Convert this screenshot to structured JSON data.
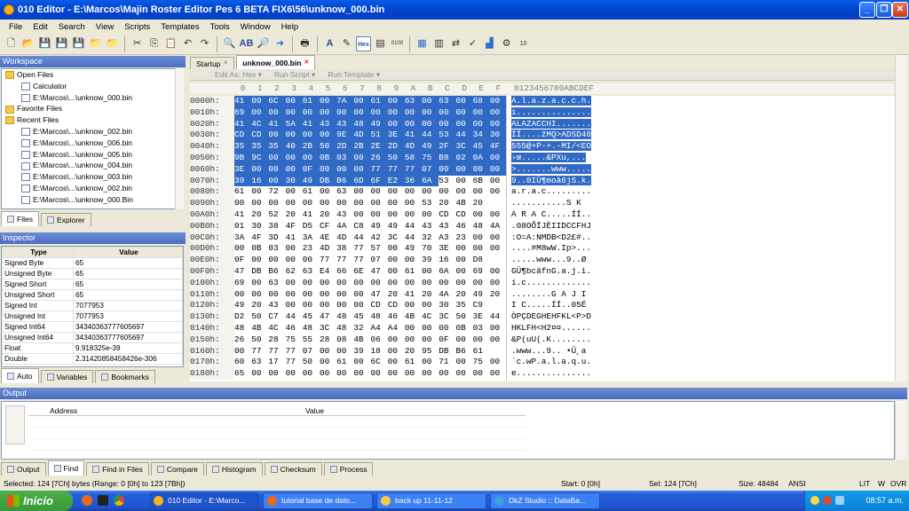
{
  "window": {
    "title": "010 Editor - E:\\Marcos\\Majin Roster Editor Pes 6 BETA FIX6\\56\\unknow_000.bin"
  },
  "menu": [
    "File",
    "Edit",
    "Search",
    "View",
    "Scripts",
    "Templates",
    "Tools",
    "Window",
    "Help"
  ],
  "workspace": {
    "title": "Workspace",
    "items": [
      {
        "label": "Open Files",
        "type": "folder",
        "indent": 0
      },
      {
        "label": "Calculator",
        "type": "doc",
        "indent": 1
      },
      {
        "label": "E:\\Marcos\\...\\unknow_000.bin",
        "type": "doc",
        "indent": 1
      },
      {
        "label": "Favorite Files",
        "type": "folder",
        "indent": 0
      },
      {
        "label": "Recent Files",
        "type": "folder",
        "indent": 0
      },
      {
        "label": "E:\\Marcos\\...\\unknow_002.bin",
        "type": "doc",
        "indent": 1
      },
      {
        "label": "E:\\Marcos\\...\\unknow_006.bin",
        "type": "doc",
        "indent": 1
      },
      {
        "label": "E:\\Marcos\\...\\unknow_005.bin",
        "type": "doc",
        "indent": 1
      },
      {
        "label": "E:\\Marcos\\...\\unknow_004.bin",
        "type": "doc",
        "indent": 1
      },
      {
        "label": "E:\\Marcos\\...\\unknow_003.bin",
        "type": "doc",
        "indent": 1
      },
      {
        "label": "E:\\Marcos\\...\\unknow_002.bin",
        "type": "doc",
        "indent": 1
      },
      {
        "label": "E:\\Marcos\\...\\unknow_000.Bin",
        "type": "doc",
        "indent": 1
      }
    ],
    "tabs": [
      "Files",
      "Explorer"
    ]
  },
  "inspector": {
    "title": "Inspector",
    "col_type": "Type",
    "col_value": "Value",
    "rows": [
      [
        "Signed Byte",
        "65"
      ],
      [
        "Unsigned Byte",
        "65"
      ],
      [
        "Signed Short",
        "65"
      ],
      [
        "Unsigned Short",
        "65"
      ],
      [
        "Signed Int",
        "7077953"
      ],
      [
        "Unsigned Int",
        "7077953"
      ],
      [
        "Signed Int64",
        "34340363777605697"
      ],
      [
        "Unsigned Int64",
        "34340363777605697"
      ],
      [
        "Float",
        "9.918325e-39"
      ],
      [
        "Double",
        "2.31420858458426e-306"
      ]
    ],
    "tabs": [
      "Auto",
      "Variables",
      "Bookmarks"
    ]
  },
  "editor": {
    "tabs": [
      "Startup",
      "unknow_000.bin"
    ],
    "edit_as": "Edit As: Hex ▾",
    "run_script": "Run Script ▾",
    "run_template": "Run Template ▾",
    "col_header": [
      "0",
      "1",
      "2",
      "3",
      "4",
      "5",
      "6",
      "7",
      "8",
      "9",
      "A",
      "B",
      "C",
      "D",
      "E",
      "F"
    ],
    "ascii_header": "0123456789ABCDEF",
    "rows": [
      {
        "addr": "0000h:",
        "bytes": "41 00 6C 00 61 00 7A 00 61 00 63 00 63 00 68 00",
        "ascii": "A.l.a.z.a.c.c.h."
      },
      {
        "addr": "0010h:",
        "bytes": "69 00 00 00 00 00 00 00 00 00 00 00 00 00 00 00",
        "ascii": "i..............."
      },
      {
        "addr": "0020h:",
        "bytes": "41 4C 41 5A 41 43 43 48 49 00 00 00 00 00 00 00",
        "ascii": "ALAZACCHI......."
      },
      {
        "addr": "0030h:",
        "bytes": "CD CD 00 00 00 00 9E 4D 51 3E 41 44 53 44 34 30",
        "ascii": "ÍÍ....žMQ>ADSD40"
      },
      {
        "addr": "0040h:",
        "bytes": "35 35 35 40 2B 50 2D 2B 2E 2D 4D 49 2F 3C 45 4F",
        "ascii": "555@+P-+.-MI/<EO"
      },
      {
        "addr": "0050h:",
        "bytes": "9B 9C 00 00 00 0B 03 00 26 50 58 75 B8 02 0A 00",
        "ascii": "›œ.....&PXu,..."
      },
      {
        "addr": "0060h:",
        "bytes": "3E 00 00 00 0F 00 00 00 77 77 77 07 00 00 00 00",
        "ascii": ">.......www....."
      },
      {
        "addr": "0070h:",
        "bytes": "39 16 00 30 49 DB B6 6D 6F E2 36 6A 53 00 6B 00",
        "ascii": "9..0IÛ¶moâ6jS.k."
      },
      {
        "addr": "0080h:",
        "bytes": "61 00 72 00 61 00 63 00 00 00 00 00 00 00 00 00",
        "ascii": "a.r.a.c........."
      },
      {
        "addr": "0090h:",
        "bytes": "00 00 00 00 00 00 00 00 00 00 00 53 20 4B 20",
        "ascii": "...........S K "
      },
      {
        "addr": "00A0h:",
        "bytes": "41 20 52 20 41 20 43 00 00 00 00 00 CD CD 00 00",
        "ascii": "A R A C.....ÍÍ.."
      },
      {
        "addr": "00B0h:",
        "bytes": "01 30 38 4F D5 CF 4A C8 49 49 44 43 43 46 48 4A",
        "ascii": ".08OÕÏJÈIIDCCFHJ"
      },
      {
        "addr": "00C0h:",
        "bytes": "3A 4F 3D 41 3A 4E 4D 44 42 3C 44 32 A3 23 00 00",
        "ascii": ":O=A:NMDB<D2£#.."
      },
      {
        "addr": "00D0h:",
        "bytes": "00 0B 03 00 23 4D 38 77 57 00 49 70 3E 00 00 00",
        "ascii": "....#M8wW.Ip>..."
      },
      {
        "addr": "00E0h:",
        "bytes": "0F 00 00 00 00 77 77 77 07 00 00 39 16 00 D8",
        "ascii": ".....www...9..Ø"
      },
      {
        "addr": "00F0h:",
        "bytes": "47 DB B6 62 63 E4 66 6E 47 00 61 00 6A 00 69 00",
        "ascii": "GÛ¶bcäfnG.a.j.i."
      },
      {
        "addr": "0100h:",
        "bytes": "69 00 63 00 00 00 00 00 00 00 00 00 00 00 00 00",
        "ascii": "i.c............."
      },
      {
        "addr": "0110h:",
        "bytes": "00 00 00 00 00 00 00 00 47 20 41 20 4A 20 49 20",
        "ascii": "........G A J I "
      },
      {
        "addr": "0120h:",
        "bytes": "49 20 43 00 00 00 00 00 CD CD 00 00 30 35 C9",
        "ascii": "I C.....ÍÍ..05É"
      },
      {
        "addr": "0130h:",
        "bytes": "D2 50 C7 44 45 47 48 45 48 46 4B 4C 3C 50 3E 44",
        "ascii": "ÒPÇDEGHEHFKL<P>D"
      },
      {
        "addr": "0140h:",
        "bytes": "48 4B 4C 46 48 3C 48 32 A4 A4 00 00 00 0B 03 00",
        "ascii": "HKLFH<H2¤¤......"
      },
      {
        "addr": "0150h:",
        "bytes": "26 50 28 75 55 28 08 4B 06 00 00 00 0F 00 00 00",
        "ascii": "&P(uU(.K........"
      },
      {
        "addr": "0160h:",
        "bytes": "00 77 77 77 07 00 00 39 18 00 20 95 DB B6 61",
        "ascii": ".www...9.. •Û¸a"
      },
      {
        "addr": "0170h:",
        "bytes": "60 63 17 77 50 00 61 00 6C 00 61 00 71 00 75 00",
        "ascii": "`c.wP.a.l.a.q.u."
      },
      {
        "addr": "0180h:",
        "bytes": "65 00 00 00 00 00 00 00 00 00 00 00 00 00 00 00",
        "ascii": "e..............."
      }
    ]
  },
  "output": {
    "title": "Output",
    "col_address": "Address",
    "col_value": "Value",
    "tabs": [
      "Output",
      "Find",
      "Find in Files",
      "Compare",
      "Histogram",
      "Checksum",
      "Process"
    ]
  },
  "status": {
    "selected": "Selected: 124 [7Ch] bytes (Range: 0 [0h] to 123 [7Bh])",
    "start": "Start: 0 [0h]",
    "sel": "Sel: 124 [7Ch]",
    "size": "Size: 48484",
    "enc": "ANSI",
    "lit": "LIT",
    "w": "W",
    "ovr": "OVR"
  },
  "taskbar": {
    "start": "Inicio",
    "tasks": [
      "010 Editor - E:\\Marco...",
      "tutorial base de dato...",
      "back up 11-11-12",
      "DkZ Studio :: DataBa..."
    ],
    "clock": "08:57 a.m."
  }
}
